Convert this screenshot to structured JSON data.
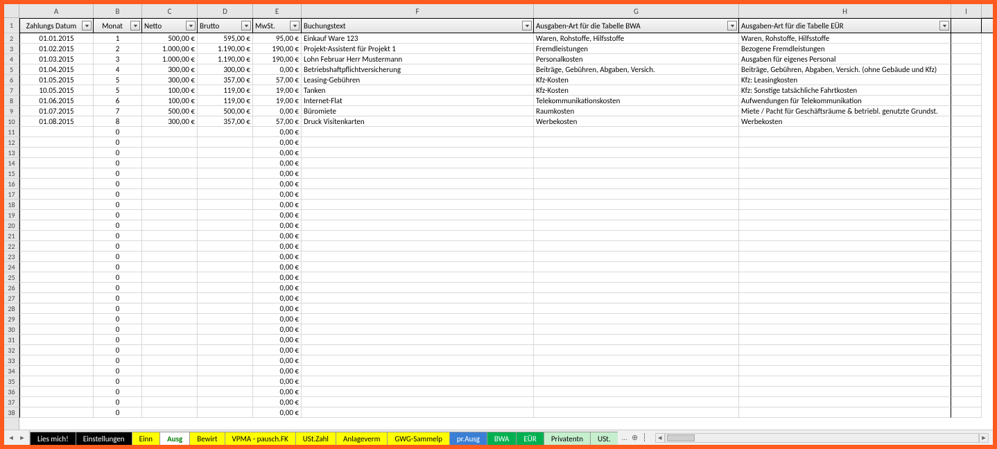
{
  "columns": {
    "letters": [
      "A",
      "B",
      "C",
      "D",
      "E",
      "F",
      "G",
      "H",
      "I"
    ],
    "filters": {
      "A": "Zahlungs Datum",
      "B": "Monat",
      "C": "Netto",
      "D": "Brutto",
      "E": "MwSt.",
      "F": "Buchungstext",
      "G": "Ausgaben-Art für die Tabelle BWA",
      "H": "Ausgaben-Art für die Tabelle EÜR"
    }
  },
  "rows": [
    {
      "A": "01.01.2015",
      "B": "1",
      "C": "500,00 €",
      "D": "595,00 €",
      "E": "95,00 €",
      "F": "Einkauf Ware 123",
      "G": "Waren, Rohstoffe, Hilfsstoffe",
      "H": "Waren, Rohstoffe, Hilfsstoffe"
    },
    {
      "A": "01.02.2015",
      "B": "2",
      "C": "1.000,00 €",
      "D": "1.190,00 €",
      "E": "190,00 €",
      "F": "Projekt-Assistent für Projekt 1",
      "G": "Fremdleistungen",
      "H": "Bezogene Fremdleistungen"
    },
    {
      "A": "01.03.2015",
      "B": "3",
      "C": "1.000,00 €",
      "D": "1.190,00 €",
      "E": "190,00 €",
      "F": "Lohn Februar Herr Mustermann",
      "G": "Personalkosten",
      "H": "Ausgaben für eigenes Personal"
    },
    {
      "A": "01.04.2015",
      "B": "4",
      "C": "300,00 €",
      "D": "300,00 €",
      "E": "0,00 €",
      "F": "Betriebshaftpflichtversicherung",
      "G": "Beiträge, Gebühren, Abgaben, Versich.",
      "H": "Beiträge, Gebühren, Abgaben, Versich. (ohne Gebäude und Kfz)"
    },
    {
      "A": "01.05.2015",
      "B": "5",
      "C": "300,00 €",
      "D": "357,00 €",
      "E": "57,00 €",
      "F": "Leasing-Gebühren",
      "G": "Kfz-Kosten",
      "H": "Kfz: Leasingkosten"
    },
    {
      "A": "10.05.2015",
      "B": "5",
      "C": "100,00 €",
      "D": "119,00 €",
      "E": "19,00 €",
      "F": "Tanken",
      "G": "Kfz-Kosten",
      "H": "Kfz: Sonstige tatsächliche Fahrtkosten"
    },
    {
      "A": "01.06.2015",
      "B": "6",
      "C": "100,00 €",
      "D": "119,00 €",
      "E": "19,00 €",
      "F": "Internet-Flat",
      "G": "Telekommunikationskosten",
      "H": "Aufwendungen für Telekommunikation"
    },
    {
      "A": "01.07.2015",
      "B": "7",
      "C": "500,00 €",
      "D": "500,00 €",
      "E": "0,00 €",
      "F": "Büromiete",
      "G": "Raumkosten",
      "H": "Miete / Pacht für Geschäftsräume & betriebl. genutzte Grundst."
    },
    {
      "A": "01.08.2015",
      "B": "8",
      "C": "300,00 €",
      "D": "357,00 €",
      "E": "57,00 €",
      "F": "Druck Visitenkarten",
      "G": "Werbekosten",
      "H": "Werbekosten"
    }
  ],
  "emptyRowCount": 28,
  "emptyRow": {
    "B": "0",
    "E": "0,00 €"
  },
  "sheetTabs": [
    {
      "label": "Lies mich!",
      "cls": "black"
    },
    {
      "label": "Einstellungen",
      "cls": "black"
    },
    {
      "label": "Einn",
      "cls": "yellow"
    },
    {
      "label": "Ausg",
      "cls": "active greenText"
    },
    {
      "label": "Bewirt",
      "cls": "yellow"
    },
    {
      "label": "VPMA - pausch.FK",
      "cls": "yellow"
    },
    {
      "label": "USt.Zahl",
      "cls": "yellow"
    },
    {
      "label": "Anlageverm",
      "cls": "yellow"
    },
    {
      "label": "GWG-Sammelp",
      "cls": "yellow"
    },
    {
      "label": "pr.Ausg",
      "cls": "blue"
    },
    {
      "label": "BWA",
      "cls": "green"
    },
    {
      "label": "EÜR",
      "cls": "green"
    },
    {
      "label": "Privatentn",
      "cls": "lgreen"
    },
    {
      "label": "USt.",
      "cls": "lgreen"
    }
  ],
  "tabMore": "...",
  "rowStart": 2,
  "lastRowNum": 39
}
